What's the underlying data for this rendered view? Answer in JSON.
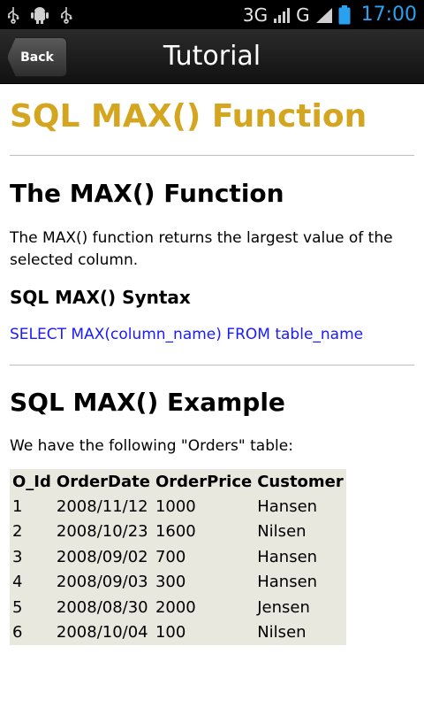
{
  "status_bar": {
    "network_1": "3G",
    "network_2": "G",
    "time": "17:00"
  },
  "action_bar": {
    "back_label": "Back",
    "title": "Tutorial"
  },
  "content": {
    "page_title": "SQL MAX() Function",
    "section1_heading": "The MAX() Function",
    "section1_text": "The MAX() function returns the largest value of the selected column.",
    "syntax_heading": "SQL MAX() Syntax",
    "syntax_code": "SELECT MAX(column_name) FROM table_name",
    "section2_heading": "SQL MAX() Example",
    "section2_text": "We have the following \"Orders\" table:",
    "table": {
      "headers": [
        "O_Id",
        "OrderDate",
        "OrderPrice",
        "Customer"
      ],
      "rows": [
        [
          "1",
          "2008/11/12",
          "1000",
          "Hansen"
        ],
        [
          "2",
          "2008/10/23",
          "1600",
          "Nilsen"
        ],
        [
          "3",
          "2008/09/02",
          "700",
          "Hansen"
        ],
        [
          "4",
          "2008/09/03",
          "300",
          "Hansen"
        ],
        [
          "5",
          "2008/08/30",
          "2000",
          "Jensen"
        ],
        [
          "6",
          "2008/10/04",
          "100",
          "Nilsen"
        ]
      ]
    }
  },
  "colors": {
    "title_gold": "#d4a620",
    "code_blue": "#1a1aff",
    "table_bg": "#e8e8df",
    "clock_blue": "#2aa0f0"
  }
}
